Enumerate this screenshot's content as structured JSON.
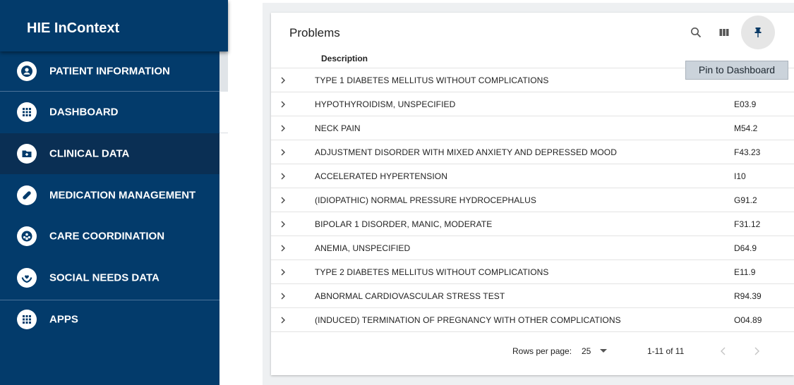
{
  "app": {
    "title": "HIE InContext"
  },
  "sidebar": {
    "items": [
      {
        "label": "PATIENT INFORMATION",
        "icon": "person-icon"
      },
      {
        "label": "DASHBOARD",
        "icon": "grid-icon"
      },
      {
        "label": "CLINICAL DATA",
        "icon": "folder-plus-icon"
      },
      {
        "label": "MEDICATION MANAGEMENT",
        "icon": "pill-icon"
      },
      {
        "label": "CARE COORDINATION",
        "icon": "care-icon"
      },
      {
        "label": "SOCIAL NEEDS DATA",
        "icon": "heart-hands-icon"
      },
      {
        "label": "APPS",
        "icon": "apps-grid-icon"
      }
    ],
    "active": "CLINICAL DATA"
  },
  "panel": {
    "title": "Problems",
    "tooltip": "Pin to Dashboard",
    "column_header": "Description",
    "rows": [
      {
        "description": "TYPE 1 DIABETES MELLITUS WITHOUT COMPLICATIONS",
        "code": ""
      },
      {
        "description": "HYPOTHYROIDISM, UNSPECIFIED",
        "code": "E03.9"
      },
      {
        "description": "NECK PAIN",
        "code": "M54.2"
      },
      {
        "description": "ADJUSTMENT DISORDER WITH MIXED ANXIETY AND DEPRESSED MOOD",
        "code": "F43.23"
      },
      {
        "description": "ACCELERATED HYPERTENSION",
        "code": "I10"
      },
      {
        "description": "(IDIOPATHIC) NORMAL PRESSURE HYDROCEPHALUS",
        "code": "G91.2"
      },
      {
        "description": "BIPOLAR 1 DISORDER, MANIC, MODERATE",
        "code": "F31.12"
      },
      {
        "description": "ANEMIA, UNSPECIFIED",
        "code": "D64.9"
      },
      {
        "description": "TYPE 2 DIABETES MELLITUS WITHOUT COMPLICATIONS",
        "code": "E11.9"
      },
      {
        "description": "ABNORMAL CARDIOVASCULAR STRESS TEST",
        "code": "R94.39"
      },
      {
        "description": "(INDUCED) TERMINATION OF PREGNANCY WITH OTHER COMPLICATIONS",
        "code": "O04.89"
      }
    ],
    "pagination": {
      "rows_per_page_label": "Rows per page:",
      "rows_per_page": "25",
      "range": "1-11 of 11"
    }
  },
  "colors": {
    "sidebar": "#033b6b",
    "active_item": "#0a2f54"
  }
}
